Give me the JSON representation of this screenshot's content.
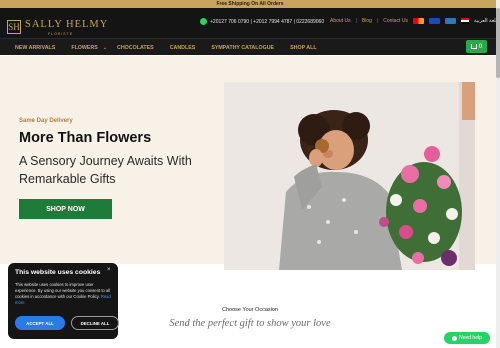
{
  "announcement": "Free Shipping On All Orders",
  "brand": {
    "name": "SALLY HELMY",
    "subtitle": "FLORISTE",
    "monogram": "SH"
  },
  "header": {
    "phones": "+20127 706 0790 | +2012 7994 4787 | 0222689060",
    "links": [
      "About Us",
      "Blog",
      "Contact Us"
    ],
    "payment_icons": [
      "mastercard-icon",
      "visa-icon",
      "amex-icon"
    ],
    "language": "اللغة العربية"
  },
  "nav": {
    "items": [
      "NEW ARRIVALS",
      "FLOWERS",
      "CHOCOLATES",
      "CANDLES",
      "SYMPATHY CATALOGUE",
      "SHOP ALL"
    ],
    "cart_count": "0"
  },
  "hero": {
    "eyebrow": "Same Day Delivery",
    "title": "More Than Flowers",
    "subtitle": "A Sensory Journey Awaits With Remarkable Gifts",
    "cta": "SHOP NOW"
  },
  "section": {
    "heading": "Choose Your Occasion",
    "tagline": "Send the perfect gift to show your love"
  },
  "cookie": {
    "title": "This website uses cookies",
    "close": "×",
    "text": "This website uses cookies to improve user experience. By using our website you consent to all cookies in accordance with our Cookie Policy.",
    "read_more": "Read more",
    "accept": "ACCEPT ALL",
    "decline": "DECLINE ALL"
  },
  "help": {
    "label": "Need help"
  },
  "colors": {
    "gold": "#c9a45c",
    "dark": "#141414",
    "green": "#1e7b3a",
    "whatsapp": "#25d366",
    "hero_bg": "#f7f1e7"
  }
}
